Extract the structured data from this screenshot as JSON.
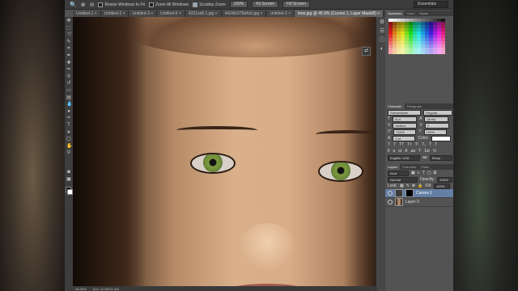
{
  "options_bar": {
    "resize_windows": "Resize Windows to Fit",
    "zoom_all": "Zoom All Windows",
    "scrubby_zoom": "Scrubby Zoom",
    "btn_100": "100%",
    "btn_fit": "Fit Screen",
    "btn_fill": "Fill Screen",
    "workspace": "Essentials"
  },
  "tabs": [
    "Untitled-1 ×",
    "Untitled-2 ×",
    "Untitled-3 ×",
    "Untitled-5 ×",
    "4321edit 1.jpg ×",
    "4424b1f78d4c5.jpg ×",
    "Untitled-2 ×",
    "liner.jpg @ 45.9% (Curves 1, Layer Mask/8) ×"
  ],
  "active_tab": 7,
  "status": {
    "zoom": "45.85%",
    "doc": "Doc: 11.4M/11.4M"
  },
  "panels": {
    "color_tabs": [
      "Swatches",
      "Color",
      "Styles"
    ],
    "character_tabs": [
      "Character",
      "Paragraph"
    ],
    "font_family": "Streamlinien",
    "font_style": "Regular",
    "size": "8 pt",
    "leading": "(Auto)",
    "kerning": "Metrics",
    "tracking": "0",
    "scale_v": "100%",
    "scale_h": "100%",
    "baseline": "0 pt",
    "color_label": "Color:",
    "language": "English: USA",
    "antialias": "Sharp",
    "layers_tabs": [
      "Layers",
      "Channels",
      "Paths"
    ],
    "kind_label": "Kind",
    "blend_mode": "Normal",
    "opacity_label": "Opacity:",
    "opacity": "100%",
    "lock_label": "Lock:",
    "fill_label": "Fill:",
    "fill": "100%",
    "layers": [
      {
        "name": "Curves 1",
        "selected": true
      },
      {
        "name": "Layer 0",
        "selected": false
      }
    ]
  },
  "colors": {
    "accent": "#647fa4",
    "ui_bg": "#535353"
  }
}
